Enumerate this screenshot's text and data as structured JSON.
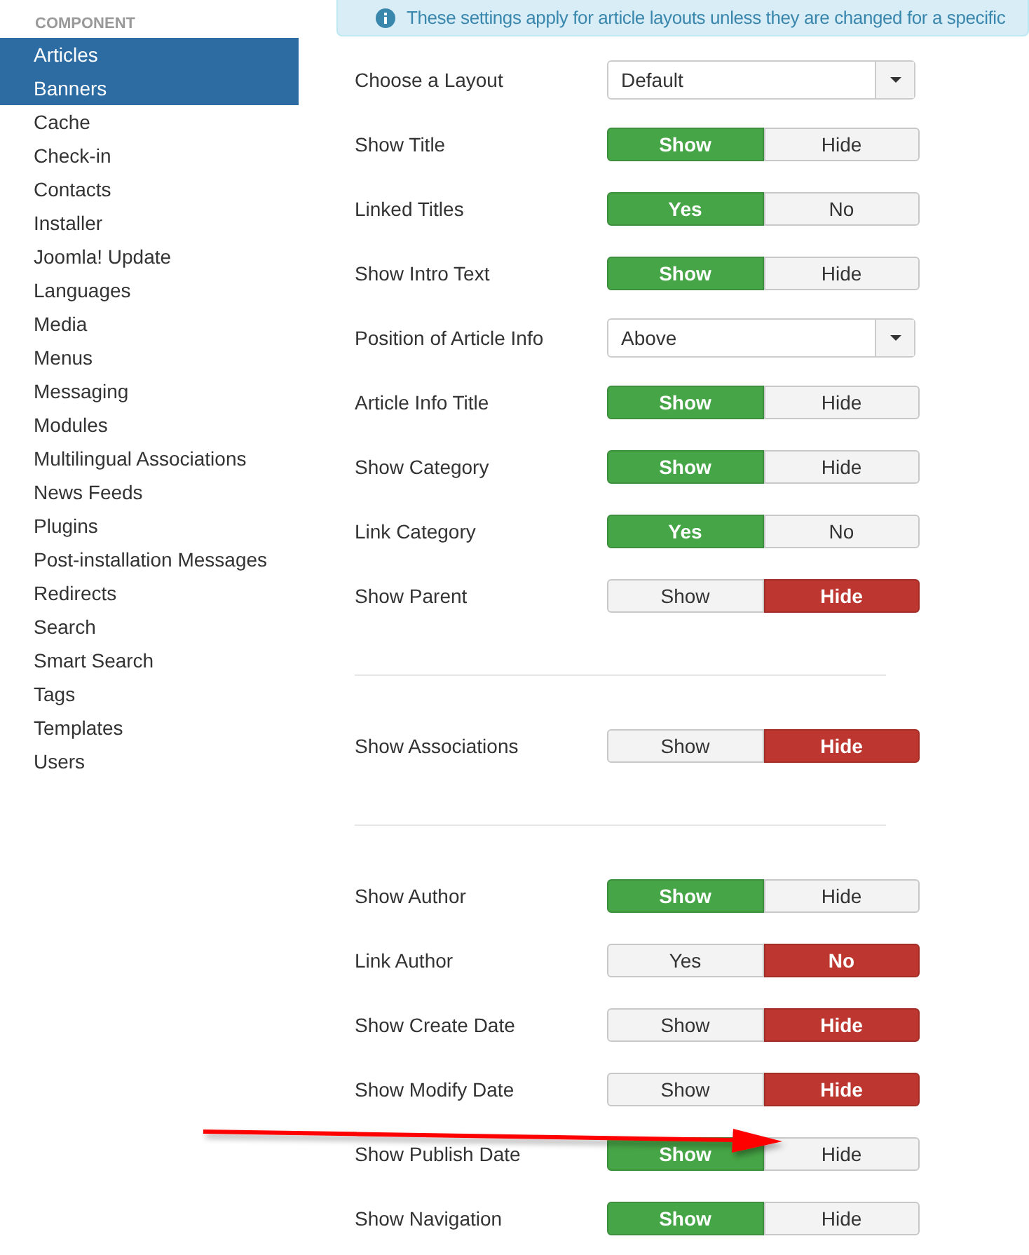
{
  "sidebar": {
    "heading": "COMPONENT",
    "items": [
      {
        "label": "Articles",
        "selected": true
      },
      {
        "label": "Banners",
        "selected": true
      },
      {
        "label": "Cache",
        "selected": false
      },
      {
        "label": "Check-in",
        "selected": false
      },
      {
        "label": "Contacts",
        "selected": false
      },
      {
        "label": "Installer",
        "selected": false
      },
      {
        "label": "Joomla! Update",
        "selected": false
      },
      {
        "label": "Languages",
        "selected": false
      },
      {
        "label": "Media",
        "selected": false
      },
      {
        "label": "Menus",
        "selected": false
      },
      {
        "label": "Messaging",
        "selected": false
      },
      {
        "label": "Modules",
        "selected": false
      },
      {
        "label": "Multilingual Associations",
        "selected": false
      },
      {
        "label": "News Feeds",
        "selected": false
      },
      {
        "label": "Plugins",
        "selected": false
      },
      {
        "label": "Post-installation Messages",
        "selected": false
      },
      {
        "label": "Redirects",
        "selected": false
      },
      {
        "label": "Search",
        "selected": false
      },
      {
        "label": "Smart Search",
        "selected": false
      },
      {
        "label": "Tags",
        "selected": false
      },
      {
        "label": "Templates",
        "selected": false
      },
      {
        "label": "Users",
        "selected": false
      }
    ]
  },
  "info": {
    "text": "These settings apply for article layouts unless they are changed for a specific"
  },
  "groups": [
    {
      "rows": [
        {
          "label": "Choose a Layout",
          "kind": "select",
          "value": "Default"
        },
        {
          "label": "Show Title",
          "kind": "toggle",
          "options": [
            {
              "label": "Show",
              "selected": true
            },
            {
              "label": "Hide",
              "selected": false
            }
          ]
        },
        {
          "label": "Linked Titles",
          "kind": "toggle",
          "options": [
            {
              "label": "Yes",
              "selected": true
            },
            {
              "label": "No",
              "selected": false
            }
          ]
        },
        {
          "label": "Show Intro Text",
          "kind": "toggle",
          "options": [
            {
              "label": "Show",
              "selected": true
            },
            {
              "label": "Hide",
              "selected": false
            }
          ]
        },
        {
          "label": "Position of Article Info",
          "kind": "select",
          "value": "Above"
        },
        {
          "label": "Article Info Title",
          "kind": "toggle",
          "options": [
            {
              "label": "Show",
              "selected": true
            },
            {
              "label": "Hide",
              "selected": false
            }
          ]
        },
        {
          "label": "Show Category",
          "kind": "toggle",
          "options": [
            {
              "label": "Show",
              "selected": true
            },
            {
              "label": "Hide",
              "selected": false
            }
          ]
        },
        {
          "label": "Link Category",
          "kind": "toggle",
          "options": [
            {
              "label": "Yes",
              "selected": true
            },
            {
              "label": "No",
              "selected": false
            }
          ]
        },
        {
          "label": "Show Parent",
          "kind": "toggle",
          "options": [
            {
              "label": "Show",
              "selected": false
            },
            {
              "label": "Hide",
              "selected": true
            }
          ]
        }
      ]
    },
    {
      "rows": [
        {
          "label": "Show Associations",
          "kind": "toggle",
          "options": [
            {
              "label": "Show",
              "selected": false
            },
            {
              "label": "Hide",
              "selected": true
            }
          ]
        }
      ]
    },
    {
      "rows": [
        {
          "label": "Show Author",
          "kind": "toggle",
          "options": [
            {
              "label": "Show",
              "selected": true
            },
            {
              "label": "Hide",
              "selected": false
            }
          ]
        },
        {
          "label": "Link Author",
          "kind": "toggle",
          "options": [
            {
              "label": "Yes",
              "selected": false
            },
            {
              "label": "No",
              "selected": true
            }
          ]
        },
        {
          "label": "Show Create Date",
          "kind": "toggle",
          "options": [
            {
              "label": "Show",
              "selected": false
            },
            {
              "label": "Hide",
              "selected": true
            }
          ]
        },
        {
          "label": "Show Modify Date",
          "kind": "toggle",
          "options": [
            {
              "label": "Show",
              "selected": false
            },
            {
              "label": "Hide",
              "selected": true
            }
          ]
        },
        {
          "label": "Show Publish Date",
          "kind": "toggle",
          "options": [
            {
              "label": "Show",
              "selected": true
            },
            {
              "label": "Hide",
              "selected": false
            }
          ]
        },
        {
          "label": "Show Navigation",
          "kind": "toggle",
          "options": [
            {
              "label": "Show",
              "selected": true
            },
            {
              "label": "Hide",
              "selected": false
            }
          ]
        }
      ]
    }
  ]
}
